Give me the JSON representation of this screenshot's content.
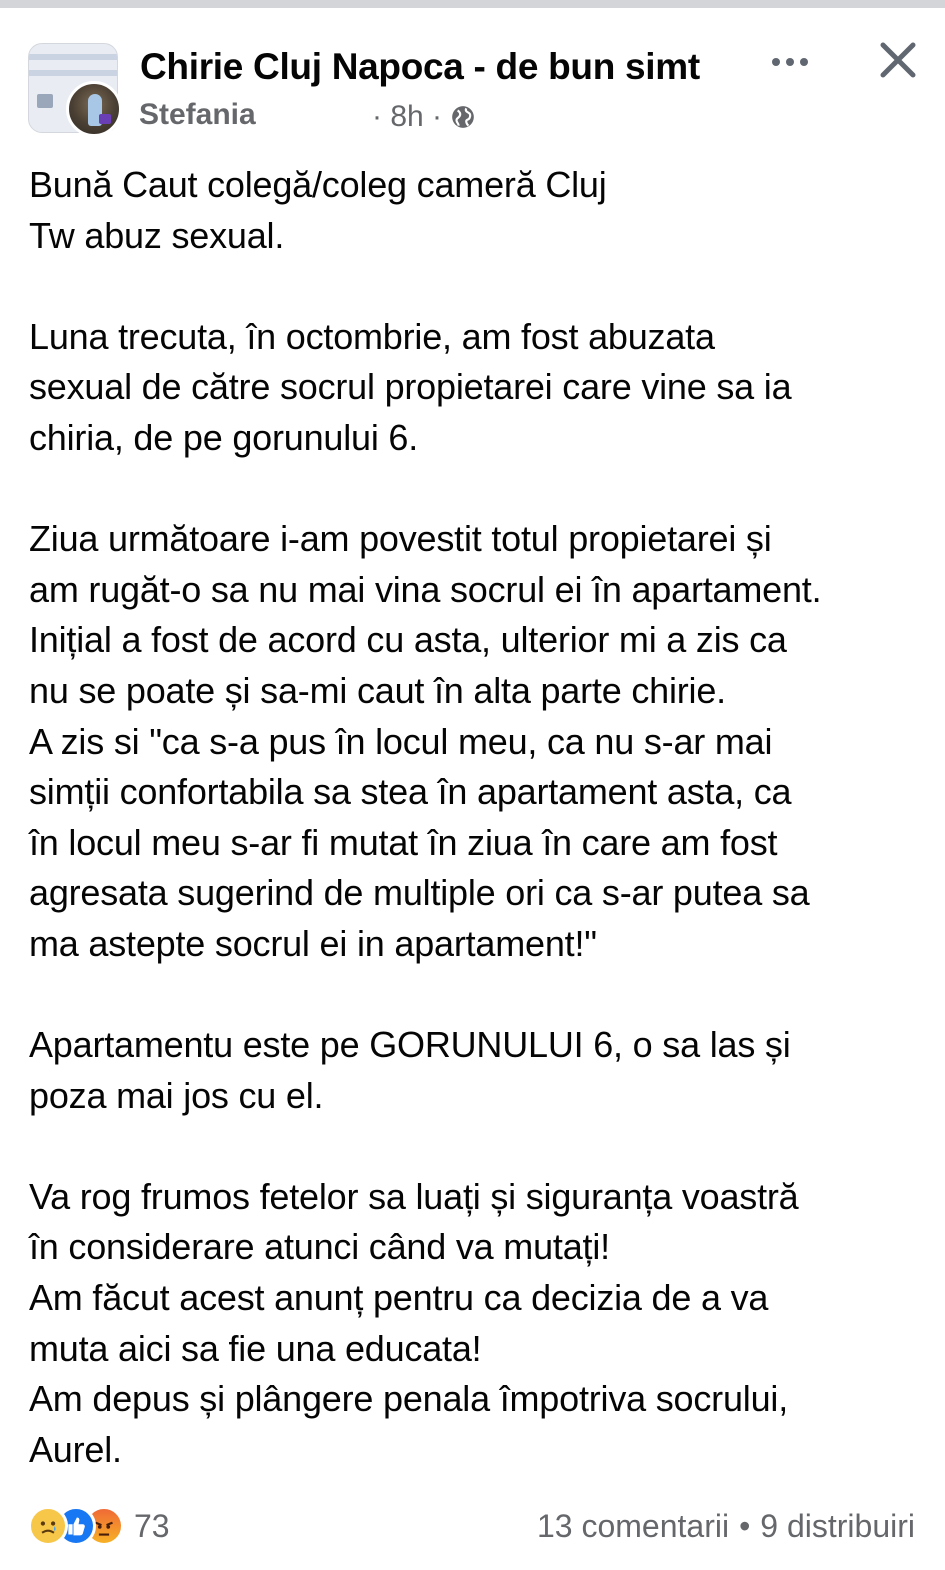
{
  "header": {
    "group_name": "Chirie Cluj Napoca - de bun simt",
    "author": "Stefania",
    "time": "· 8h ·",
    "privacy_icon": "globe-icon",
    "more_icon": "more-options-icon",
    "close_icon": "close-icon"
  },
  "post": {
    "paragraphs": [
      "Bună Caut colegă/coleg cameră Cluj\nTw abuz sexual.",
      "Luna trecuta, în octombrie, am fost abuzata\nsexual de către socrul propietarei care vine sa ia\nchiria, de pe gorunului 6.",
      "Ziua următoare i-am povestit totul propietarei și\nam rugăt-o sa nu mai vina socrul ei în apartament.\nInițial a fost de acord cu asta, ulterior mi a zis ca\nnu se poate și sa-mi caut în alta parte chirie.\nA zis si \"ca s-a pus în locul meu, ca nu s-ar mai\nsimții confortabila sa stea în apartament asta, ca\nîn locul meu s-ar fi mutat în ziua în care am fost\nagresata sugerind de multiple ori ca s-ar putea sa\nma astepte socrul ei in apartament!\"",
      "Apartamentu este pe GORUNULUI 6, o sa las și\npoza mai jos cu el.",
      "Va rog frumos fetelor sa luați și siguranța voastră\nîn considerare atunci când va mutați!\nAm făcut acest anunț pentru ca decizia de a va\nmuta aici sa fie una educata!\nAm depus și plângere penala împotriva socrului,\n           Aurel."
    ]
  },
  "footer": {
    "reactions": [
      "sad-reaction-icon",
      "like-reaction-icon",
      "angry-reaction-icon"
    ],
    "reaction_count": "73",
    "comments": "13 comentarii",
    "separator": "•",
    "shares": "9 distribuiri"
  }
}
